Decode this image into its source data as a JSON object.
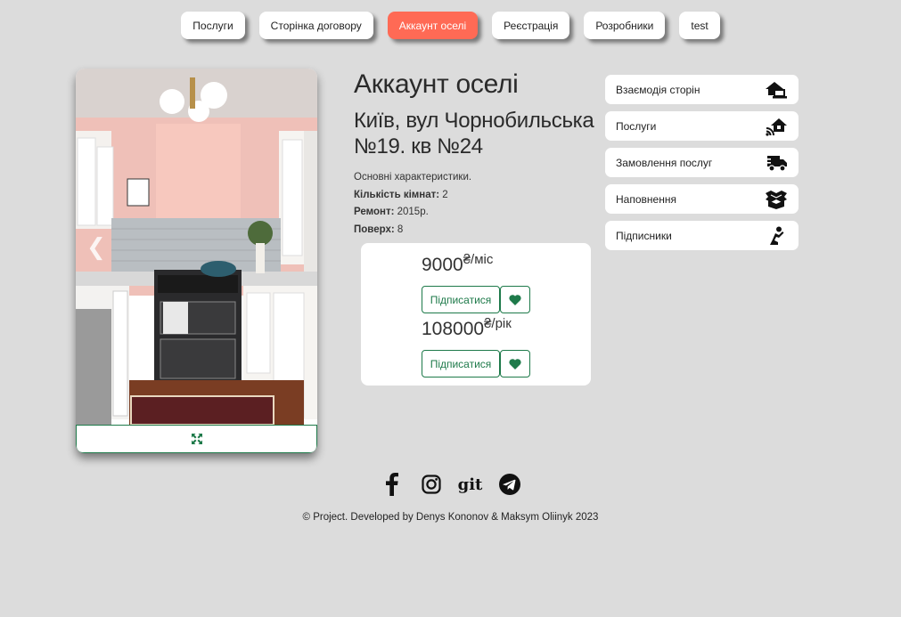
{
  "nav": {
    "items": [
      {
        "label": "Послуги"
      },
      {
        "label": "Сторінка договору"
      },
      {
        "label": "Аккаунт оселі"
      },
      {
        "label": "Реєстрація"
      },
      {
        "label": "Розробники"
      },
      {
        "label": "test"
      }
    ],
    "active_index": 2,
    "active_color": "#ff6a55"
  },
  "property": {
    "title": "Аккаунт оселі",
    "address": "Київ, вул Чорнобильська №19. кв №24",
    "specs_heading": "Основні характеристики.",
    "rooms_label": "Кількість кімнат:",
    "rooms_value": "2",
    "renovation_label": "Ремонт:",
    "renovation_value": "2015р.",
    "floor_label": "Поверх:",
    "floor_value": "8"
  },
  "pricing": [
    {
      "amount": "9000",
      "unit": "₴/міс",
      "subscribe_label": "Підписатися"
    },
    {
      "amount": "108000",
      "unit": "₴/рік",
      "subscribe_label": "Підписатися"
    }
  ],
  "side_menu": {
    "items": [
      {
        "label": "Взаємодія сторін",
        "icon": "house-laptop-icon"
      },
      {
        "label": "Послуги",
        "icon": "house-signal-icon"
      },
      {
        "label": "Замовлення послуг",
        "icon": "truck-fast-icon"
      },
      {
        "label": "Наповнення",
        "icon": "box-open-icon"
      },
      {
        "label": "Підписники",
        "icon": "person-praying-icon"
      }
    ]
  },
  "footer": {
    "socials": [
      "facebook-icon",
      "instagram-icon",
      "git",
      "telegram-icon"
    ],
    "git_label": "git",
    "copyright": "© Project. Developed by Denys Kononov & Maksym Oliinyk 2023"
  },
  "colors": {
    "background": "#dcdcdc",
    "accent_green": "#1e7a4a",
    "active_nav": "#ff6a55"
  }
}
